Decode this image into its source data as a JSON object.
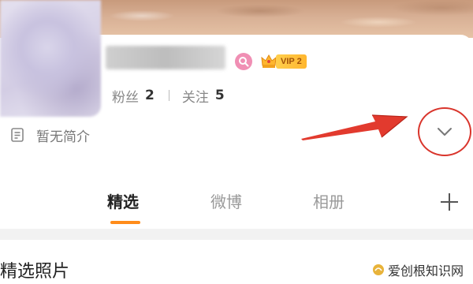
{
  "profile": {
    "vip_label": "VIP 2",
    "stats": {
      "fans_label": "粉丝",
      "fans_count": "2",
      "following_label": "关注",
      "following_count": "5"
    },
    "bio": "暂无简介"
  },
  "tabs": [
    {
      "label": "精选",
      "active": true
    },
    {
      "label": "微博",
      "active": false
    },
    {
      "label": "相册",
      "active": false
    }
  ],
  "section": {
    "title": "精选照片"
  },
  "watermark": {
    "text": "爱创根知识网"
  },
  "icons": {
    "search_badge": "search-icon",
    "vip": "crown-icon",
    "bio": "document-icon",
    "expand": "chevron-down-icon",
    "add": "plus-icon"
  },
  "colors": {
    "accent": "#ff8c1a",
    "annotation_red": "#d9352c",
    "vip_gold": "#ffb62e",
    "search_badge_pink": "#f08fb4"
  }
}
